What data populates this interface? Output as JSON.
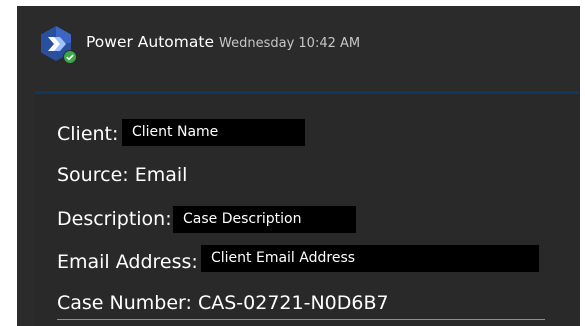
{
  "message": {
    "sender": "Power Automate",
    "timestamp": "Wednesday 10:42 AM",
    "avatar_icon": "power-automate-logo",
    "status_icon": "check-badge-icon"
  },
  "card": {
    "client_label": "Client:",
    "client_value": "Client Name",
    "source_line": "Source: Email",
    "description_label": "Description:",
    "description_value": "Case Description",
    "email_label": "Email Address:",
    "email_value": "Client Email Address",
    "case_number_line": "Case Number: CAS-02721-N0D6B7"
  },
  "colors": {
    "background": "#2b2b2b",
    "accent": "#13375c",
    "redaction": "#000000",
    "badge": "#3aa845"
  }
}
